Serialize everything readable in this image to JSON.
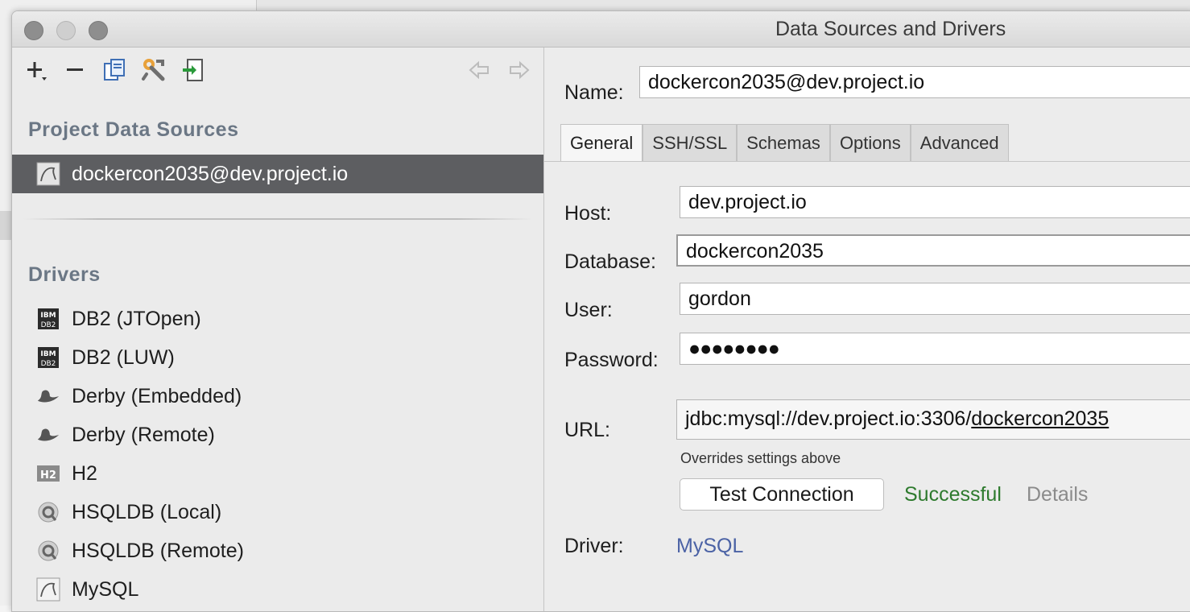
{
  "window": {
    "title": "Data Sources and Drivers"
  },
  "toolbar": {
    "add_icon": "plus-icon",
    "remove_icon": "minus-icon",
    "copy_icon": "copy-icon",
    "settings_icon": "wrench-icon",
    "import_icon": "import-icon",
    "back_icon": "arrow-left-icon",
    "forward_icon": "arrow-right-icon"
  },
  "project_sources": {
    "title": "Project Data Sources",
    "items": [
      {
        "label": "dockercon2035@dev.project.io",
        "icon": "mysql-icon",
        "selected": true
      }
    ]
  },
  "drivers": {
    "title": "Drivers",
    "items": [
      {
        "label": "DB2 (JTOpen)",
        "icon": "ibm-db2-icon"
      },
      {
        "label": "DB2 (LUW)",
        "icon": "ibm-db2-icon"
      },
      {
        "label": "Derby (Embedded)",
        "icon": "derby-hat-icon"
      },
      {
        "label": "Derby (Remote)",
        "icon": "derby-hat-icon"
      },
      {
        "label": "H2",
        "icon": "h2-icon"
      },
      {
        "label": "HSQLDB (Local)",
        "icon": "hsqldb-icon"
      },
      {
        "label": "HSQLDB (Remote)",
        "icon": "hsqldb-icon"
      },
      {
        "label": "MySQL",
        "icon": "mysql-icon"
      }
    ]
  },
  "form": {
    "name_label": "Name:",
    "name_value": "dockercon2035@dev.project.io",
    "tabs": [
      "General",
      "SSH/SSL",
      "Schemas",
      "Options",
      "Advanced"
    ],
    "active_tab": "General",
    "host_label": "Host:",
    "host_value": "dev.project.io",
    "database_label": "Database:",
    "database_value": "dockercon2035",
    "user_label": "User:",
    "user_value": "gordon",
    "password_label": "Password:",
    "password_value": "●●●●●●●●",
    "url_label": "URL:",
    "url_prefix": "jdbc:mysql://dev.project.io:3306/",
    "url_db": "dockercon2035",
    "url_hint": "Overrides settings above",
    "test_button": "Test Connection",
    "test_status": "Successful",
    "details_link": "Details",
    "driver_label": "Driver:",
    "driver_value": "MySQL"
  },
  "colors": {
    "selection": "#5d5e61",
    "success": "#2d7a2d",
    "link": "#4b62a5",
    "section_title": "#6b7785"
  }
}
